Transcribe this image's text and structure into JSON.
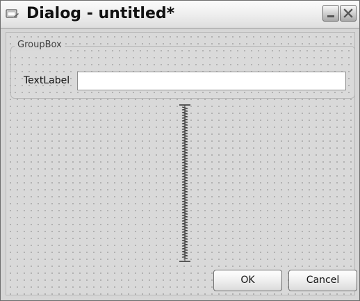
{
  "window": {
    "title": "Dialog - untitled*"
  },
  "icons": {
    "app": "designer-dialog-icon",
    "minimize": "minimize-icon",
    "close": "close-icon"
  },
  "groupbox": {
    "title": "GroupBox"
  },
  "form": {
    "label": "TextLabel",
    "input_value": ""
  },
  "buttons": {
    "ok": "OK",
    "cancel": "Cancel"
  },
  "colors": {
    "window_background": "#d6d6d6",
    "grid_dot": "#a9a9a9",
    "input_background": "#ffffff",
    "title_text": "#111111"
  }
}
